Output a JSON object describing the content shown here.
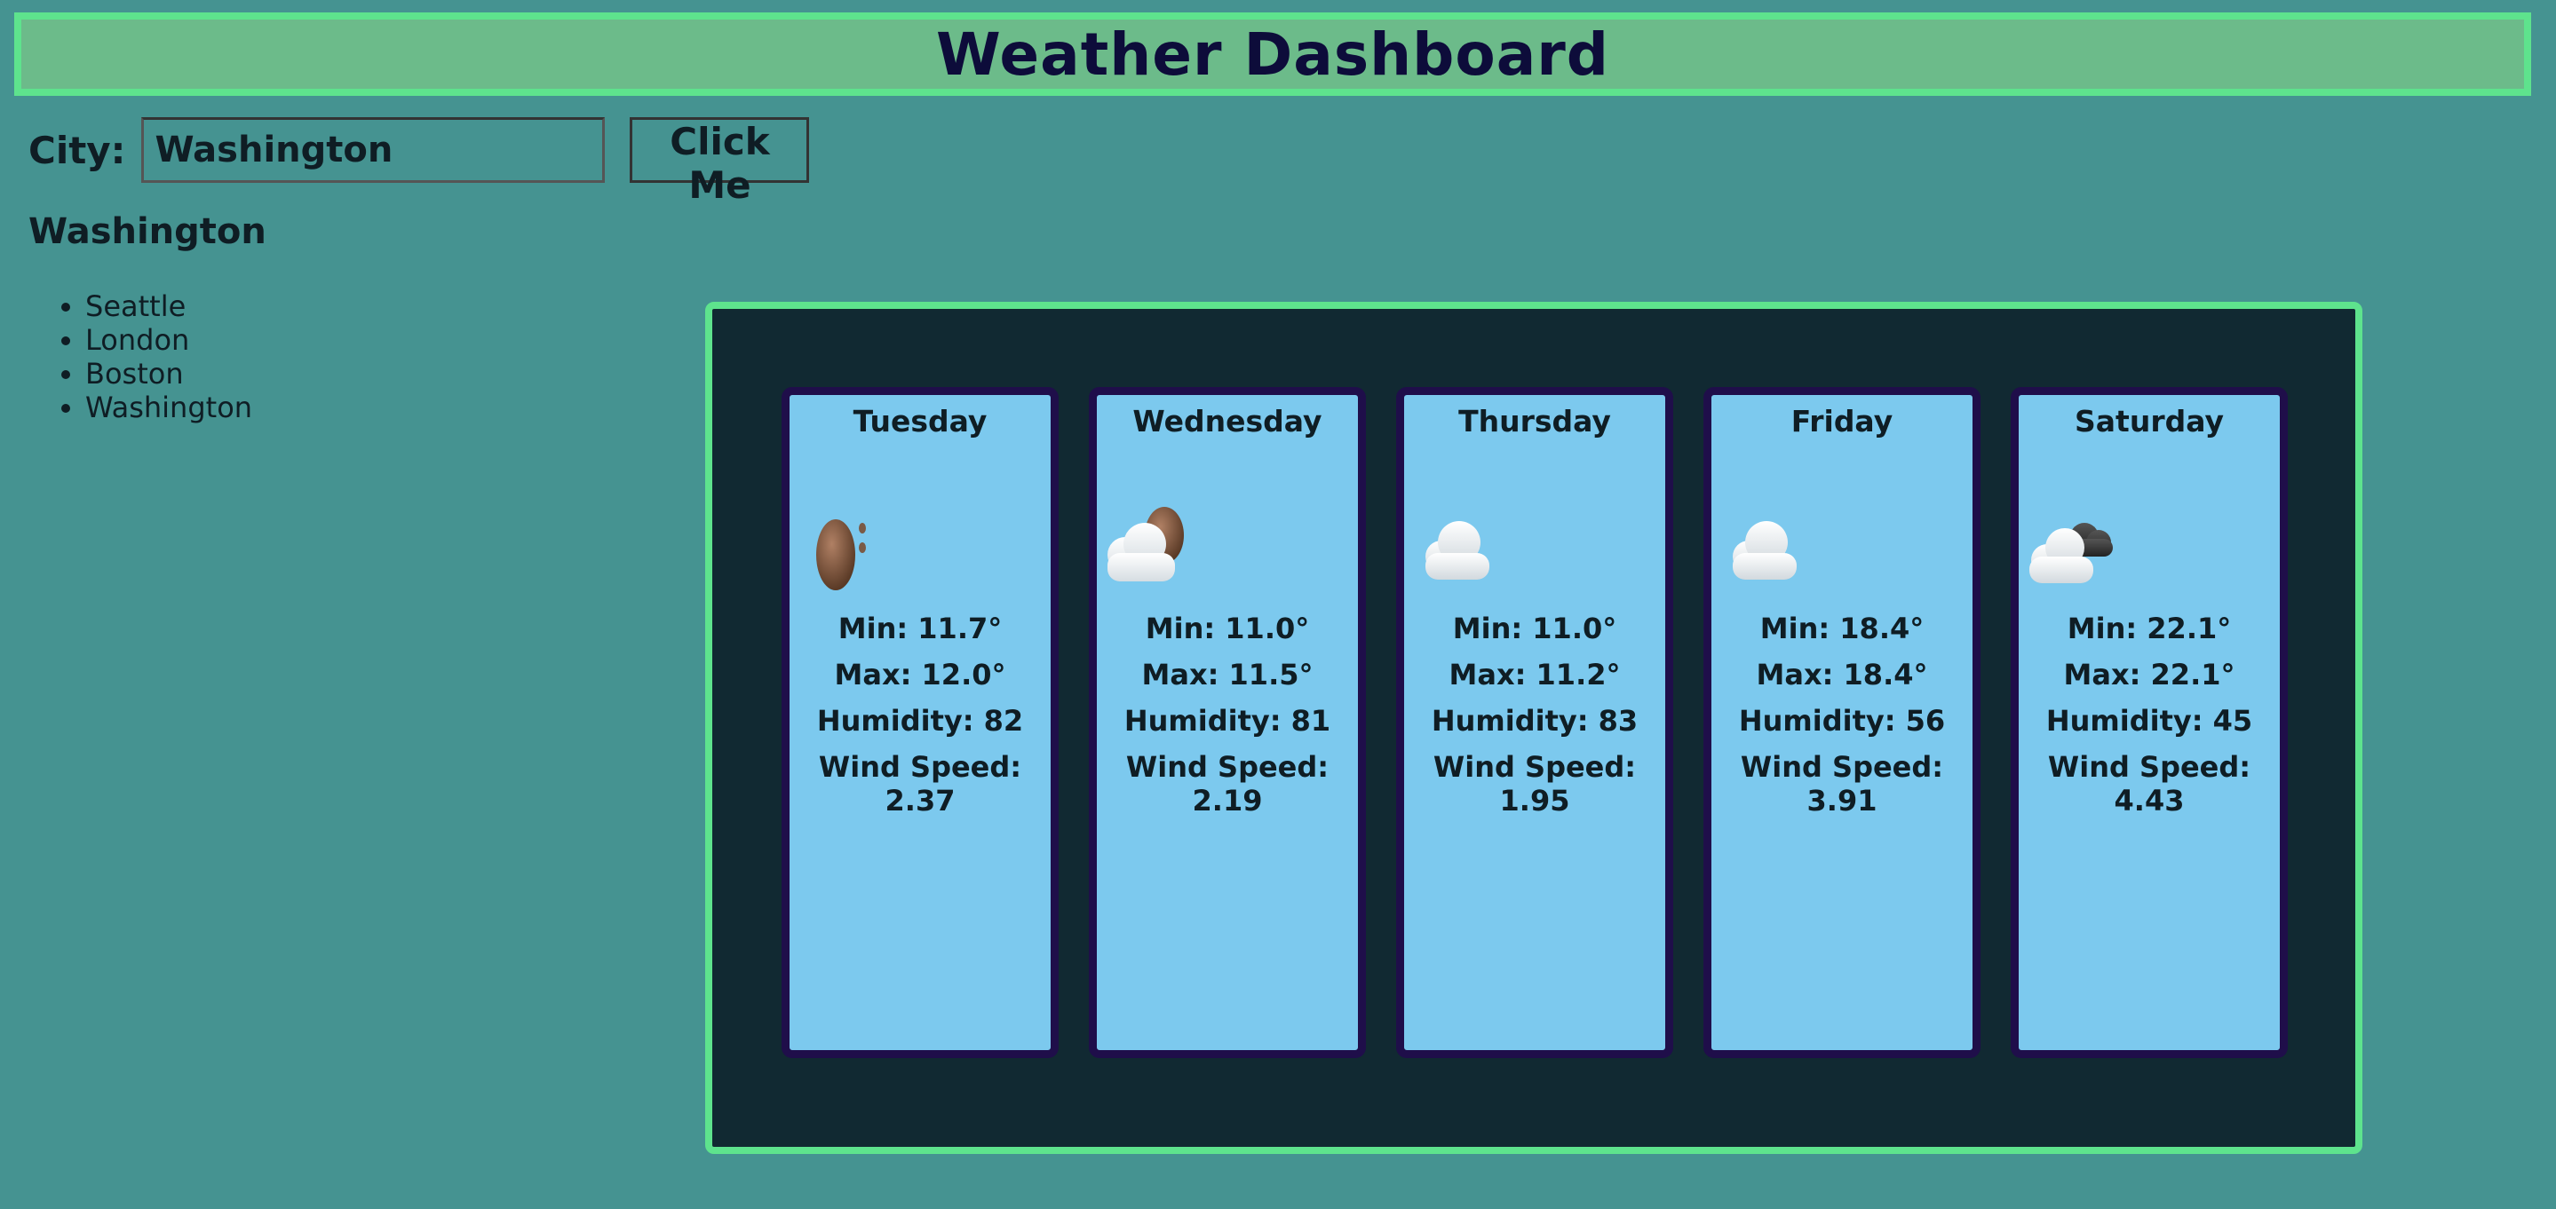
{
  "header": {
    "title": "Weather Dashboard"
  },
  "search": {
    "label": "City:",
    "value": "Washington",
    "button_label": "Click Me"
  },
  "current_city": "Washington",
  "history": [
    "Seattle",
    "London",
    "Boston",
    "Washington"
  ],
  "forecast": [
    {
      "day": "Tuesday",
      "icon": "rain-icon",
      "min": "Min: 11.7°",
      "max": "Max: 12.0°",
      "humidity": "Humidity: 82",
      "wind_label": "Wind Speed:",
      "wind": "2.37"
    },
    {
      "day": "Wednesday",
      "icon": "cloud-sun-icon",
      "min": "Min: 11.0°",
      "max": "Max: 11.5°",
      "humidity": "Humidity: 81",
      "wind_label": "Wind Speed:",
      "wind": "2.19"
    },
    {
      "day": "Thursday",
      "icon": "cloud-icon",
      "min": "Min: 11.0°",
      "max": "Max: 11.2°",
      "humidity": "Humidity: 83",
      "wind_label": "Wind Speed:",
      "wind": "1.95"
    },
    {
      "day": "Friday",
      "icon": "cloud-icon",
      "min": "Min: 18.4°",
      "max": "Max: 18.4°",
      "humidity": "Humidity: 56",
      "wind_label": "Wind Speed:",
      "wind": "3.91"
    },
    {
      "day": "Saturday",
      "icon": "broken-clouds-icon",
      "min": "Min: 22.1°",
      "max": "Max: 22.1°",
      "humidity": "Humidity: 45",
      "wind_label": "Wind Speed:",
      "wind": "4.43"
    }
  ]
}
